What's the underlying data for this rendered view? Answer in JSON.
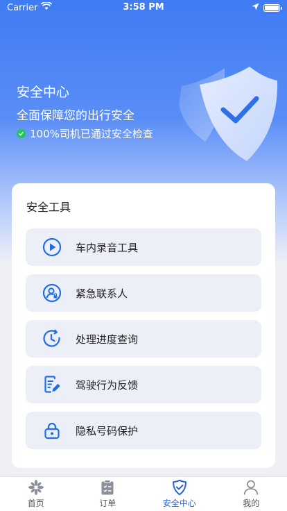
{
  "status_bar": {
    "carrier": "Carrier",
    "time": "3:58 PM"
  },
  "hero": {
    "title": "安全中心",
    "subtitle": "全面保障您的出行安全",
    "check_text": "100%司机已通过安全检查"
  },
  "safety_tools": {
    "title": "安全工具",
    "items": [
      {
        "label": "车内录音工具",
        "icon": "play-circle-icon"
      },
      {
        "label": "紧急联系人",
        "icon": "contact-icon"
      },
      {
        "label": "处理进度查询",
        "icon": "progress-clock-icon"
      },
      {
        "label": "驾驶行为反馈",
        "icon": "feedback-edit-icon"
      },
      {
        "label": "隐私号码保护",
        "icon": "lock-icon"
      }
    ]
  },
  "tabbar": {
    "tabs": [
      {
        "label": "首页",
        "icon": "home-pinwheel-icon"
      },
      {
        "label": "订单",
        "icon": "order-clipboard-icon"
      },
      {
        "label": "安全中心",
        "icon": "shield-check-icon",
        "active": true
      },
      {
        "label": "我的",
        "icon": "profile-icon"
      }
    ]
  },
  "colors": {
    "accent": "#2c5fd8",
    "icon_blue": "#1e6ee8",
    "success": "#22c55e"
  }
}
